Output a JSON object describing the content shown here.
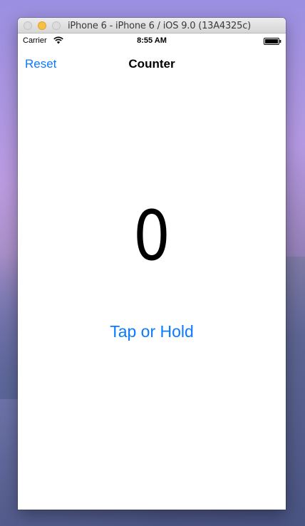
{
  "window": {
    "title": "iPhone 6 - iPhone 6 / iOS 9.0 (13A4325c)"
  },
  "status_bar": {
    "carrier": "Carrier",
    "time": "8:55 AM",
    "wifi_icon": "wifi-icon",
    "battery_icon": "battery-icon"
  },
  "nav": {
    "left_button": "Reset",
    "title": "Counter"
  },
  "main": {
    "counter": "0",
    "action_button": "Tap or Hold"
  },
  "colors": {
    "accent": "#0a7aff",
    "text": "#000000",
    "background": "#ffffff"
  }
}
